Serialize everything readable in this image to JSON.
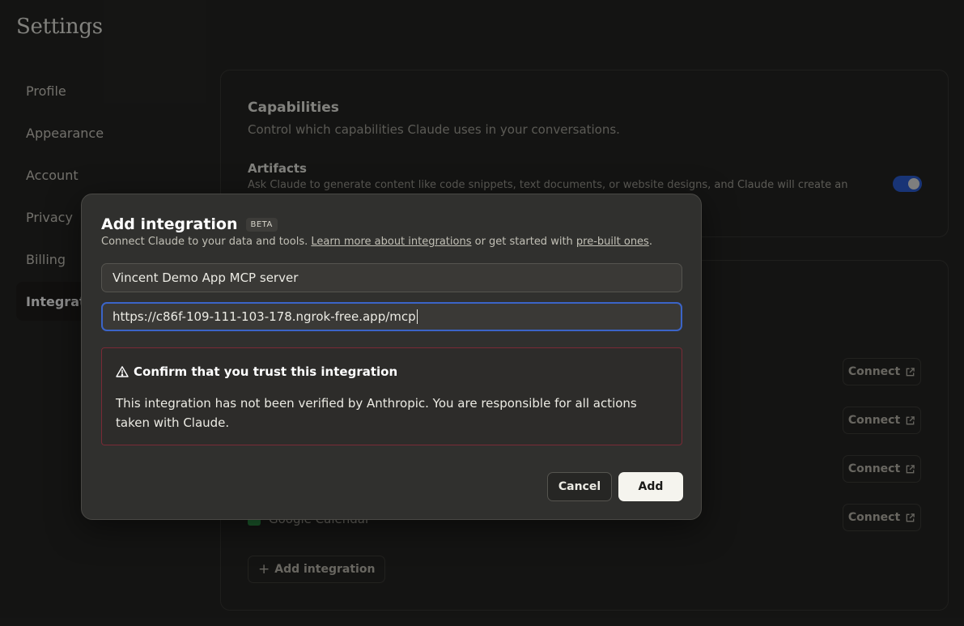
{
  "page": {
    "title": "Settings"
  },
  "sidebar": {
    "items": [
      {
        "label": "Profile"
      },
      {
        "label": "Appearance"
      },
      {
        "label": "Account"
      },
      {
        "label": "Privacy"
      },
      {
        "label": "Billing"
      },
      {
        "label": "Integrations",
        "active": true
      }
    ]
  },
  "capabilities": {
    "title": "Capabilities",
    "subtitle": "Control which capabilities Claude uses in your conversations.",
    "artifacts_title": "Artifacts",
    "artifacts_desc": "Ask Claude to generate content like code snippets, text documents, or website designs, and Claude will create an",
    "artifacts_enabled": true
  },
  "integrations": {
    "connect_label": "Connect",
    "google_calendar_label": "Google Calendar",
    "add_integration_label": "Add integration"
  },
  "modal": {
    "title": "Add integration",
    "badge": "BETA",
    "subtitle_prefix": "Connect Claude to your data and tools.",
    "learn_more_link": "Learn more about integrations",
    "subtitle_middle": "or get started with",
    "prebuilt_link": "pre-built ones",
    "subtitle_suffix": ".",
    "name_value": "Vincent Demo App MCP server",
    "url_value": "https://c86f-109-111-103-178.ngrok-free.app/mcp",
    "warning_title": "Confirm that you trust this integration",
    "warning_body": "This integration has not been verified by Anthropic. You are responsible for all actions taken with Claude.",
    "cancel_label": "Cancel",
    "add_label": "Add"
  },
  "colors": {
    "background": "#262624",
    "accent_focus": "#3b64c7",
    "toggle_on": "#2c5fd8",
    "warning_border": "#7a2a36"
  }
}
